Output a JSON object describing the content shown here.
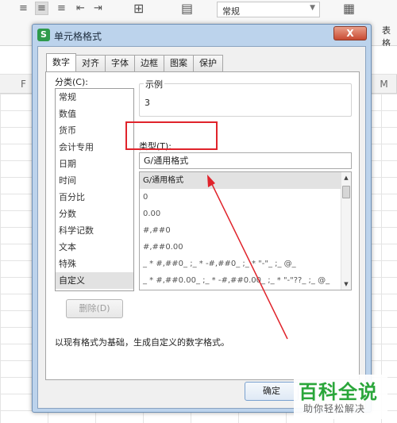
{
  "ribbon": {
    "number_format_value": "常规",
    "right_label": "表格"
  },
  "columns": [
    "F",
    "M"
  ],
  "dialog": {
    "title": "单元格格式",
    "app_icon_letter": "S",
    "close_label": "X",
    "tabs": [
      {
        "label": "数字",
        "active": true
      },
      {
        "label": "对齐",
        "active": false
      },
      {
        "label": "字体",
        "active": false
      },
      {
        "label": "边框",
        "active": false
      },
      {
        "label": "图案",
        "active": false
      },
      {
        "label": "保护",
        "active": false
      }
    ],
    "category_label": "分类(C):",
    "categories": [
      "常规",
      "数值",
      "货币",
      "会计专用",
      "日期",
      "时间",
      "百分比",
      "分数",
      "科学记数",
      "文本",
      "特殊",
      "自定义"
    ],
    "selected_category": "自定义",
    "sample_label": "示例",
    "sample_value": "3",
    "type_label": "类型(T):",
    "type_value": "G/通用格式",
    "type_list": [
      "G/通用格式",
      "0",
      "0.00",
      "#,##0",
      "#,##0.00",
      "_ * #,##0_ ;_ * -#,##0_ ;_ * \"-\"_ ;_ @_",
      "_ * #,##0.00_ ;_ * -#,##0.00_ ;_ * \"-\"??_ ;_ @_"
    ],
    "delete_label": "删除(D)",
    "description": "以现有格式为基础，生成自定义的数字格式。",
    "ok_label": "确定"
  },
  "watermark": {
    "title": "百科全说",
    "subtitle": "助你轻松解决"
  },
  "colors": {
    "annotation_red": "#e0232b",
    "watermark_green": "#2aa63a",
    "titlebar": "#bcd3ec"
  }
}
